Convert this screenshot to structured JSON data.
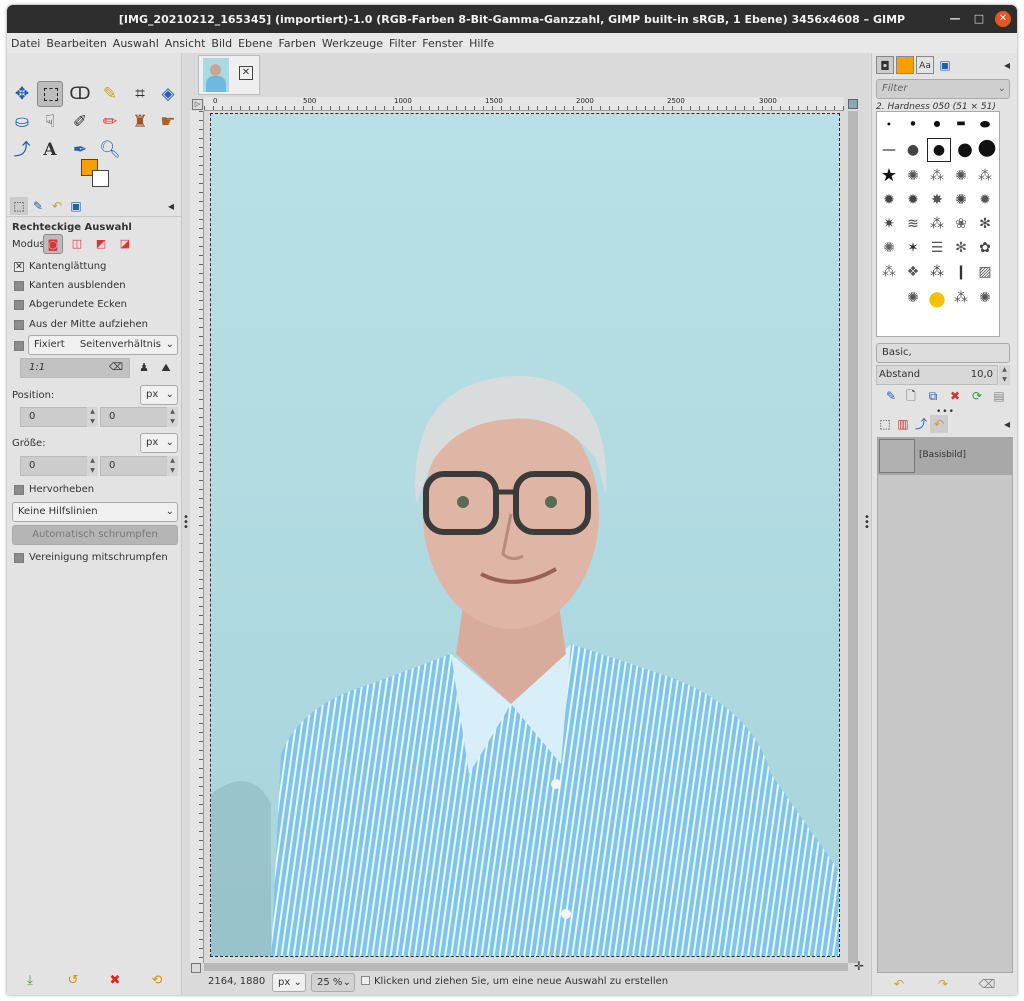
{
  "window": {
    "title": "[IMG_20210212_165345] (importiert)-1.0 (RGB-Farben 8-Bit-Gamma-Ganzzahl, GIMP built-in sRGB, 1 Ebene) 3456x4608 – GIMP"
  },
  "menu": [
    "Datei",
    "Bearbeiten",
    "Auswahl",
    "Ansicht",
    "Bild",
    "Ebene",
    "Farben",
    "Werkzeuge",
    "Filter",
    "Fenster",
    "Hilfe"
  ],
  "toolbox": {
    "colors": {
      "foreground": "#f7a000",
      "background": "#ffffff"
    }
  },
  "tool_options": {
    "title": "Rechteckige Auswahl",
    "mode_label": "Modus:",
    "antialias": "Kantenglättung",
    "feather": "Kanten ausblenden",
    "rounded": "Abgerundete Ecken",
    "expand_center": "Aus der Mitte aufziehen",
    "fixed": "Fixiert",
    "fixed_option": "Seitenverhältnis",
    "ratio": "1:1",
    "position_label": "Position:",
    "size_label": "Größe:",
    "unit": "px",
    "pos_x": "0",
    "pos_y": "0",
    "size_w": "0",
    "size_h": "0",
    "highlight": "Hervorheben",
    "guides": "Keine Hilfslinien",
    "autoshrink": "Automatisch schrumpfen",
    "shrink_merged": "Vereinigung mitschrumpfen"
  },
  "ruler": {
    "labels": [
      "0",
      "500",
      "1000",
      "1500",
      "2000",
      "2500",
      "3000"
    ]
  },
  "status": {
    "coords": "2164, 1880",
    "unit": "px",
    "zoom": "25 %",
    "message": "Klicken und ziehen Sie, um eine neue Auswahl zu erstellen"
  },
  "brushes": {
    "filter_placeholder": "Filter",
    "current": "2. Hardness 050 (51 × 51)",
    "tag": "Basic,",
    "spacing_label": "Abstand",
    "spacing_value": "10,0"
  },
  "layers": {
    "items": [
      {
        "name": "[Basisbild]"
      }
    ]
  }
}
